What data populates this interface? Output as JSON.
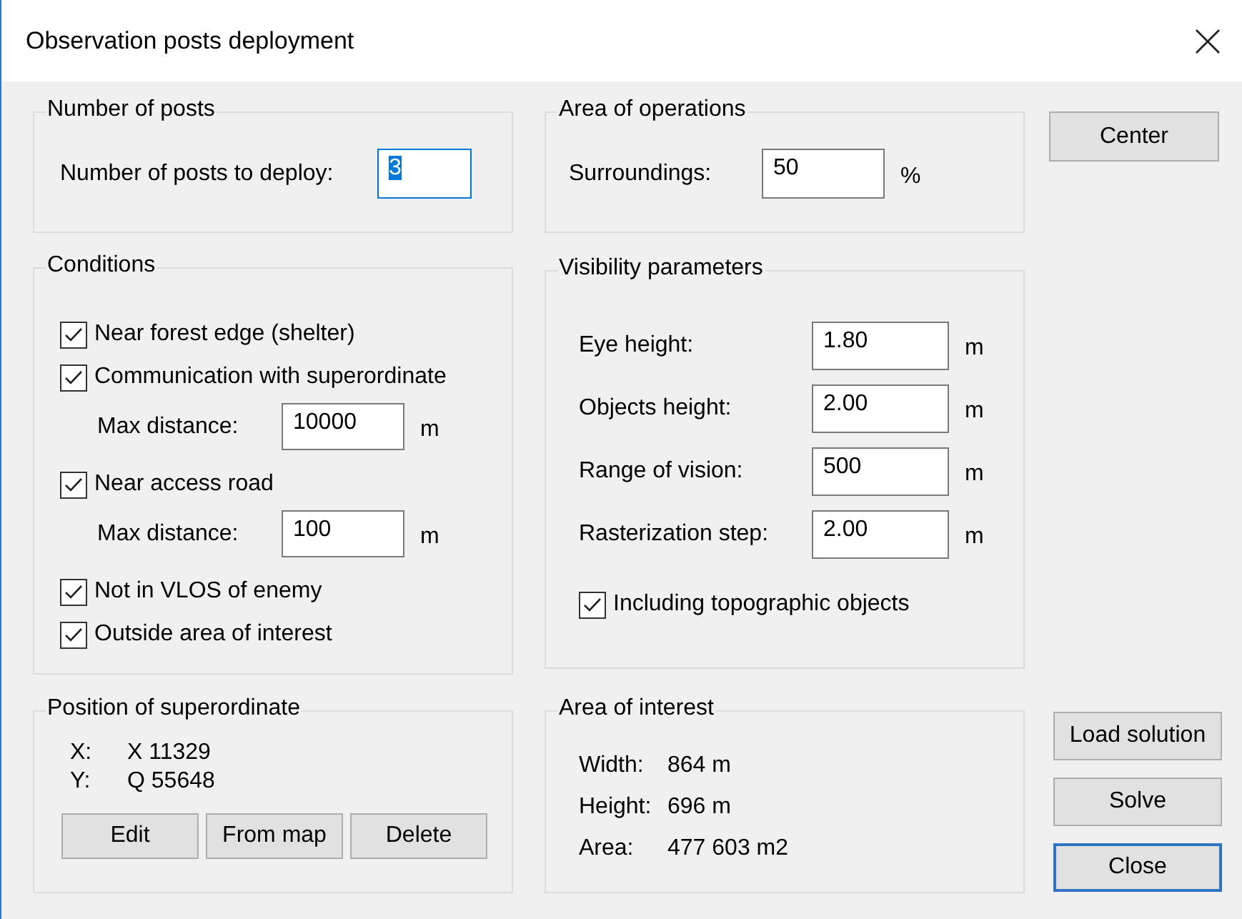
{
  "window": {
    "title": "Observation posts deployment"
  },
  "number_of_posts": {
    "title": "Number of posts",
    "fields": [
      {
        "label": "Number of posts to deploy:",
        "value": "3",
        "focused": true
      }
    ]
  },
  "conditions": {
    "title": "Conditions",
    "items": [
      {
        "kind": "checkbox",
        "label": "Near forest edge (shelter)",
        "checked": true
      },
      {
        "kind": "checkbox",
        "label": "Communication with superordinate",
        "checked": true
      },
      {
        "kind": "field",
        "label": "Max distance:",
        "value": "10000",
        "unit": "m"
      },
      {
        "kind": "checkbox",
        "label": "Near access road",
        "checked": true
      },
      {
        "kind": "field",
        "label": "Max distance:",
        "value": "100",
        "unit": "m"
      },
      {
        "kind": "checkbox",
        "label": "Not in VLOS of enemy",
        "checked": true
      },
      {
        "kind": "checkbox",
        "label": "Outside area of interest",
        "checked": true
      }
    ]
  },
  "position_of_superordinate": {
    "title": "Position of superordinate",
    "coords": [
      {
        "label": "X:",
        "value": "X 11329"
      },
      {
        "label": "Y:",
        "value": "Q 55648"
      }
    ],
    "buttons": [
      "Edit",
      "From map",
      "Delete"
    ]
  },
  "area_of_operations": {
    "title": "Area of operations",
    "fields": [
      {
        "label": "Surroundings:",
        "value": "50",
        "unit": "%",
        "focused": false
      }
    ]
  },
  "visibility_parameters": {
    "title": "Visibility parameters",
    "items": [
      {
        "kind": "field",
        "label": "Eye height:",
        "value": "1.80",
        "unit": "m"
      },
      {
        "kind": "field",
        "label": "Objects height:",
        "value": "2.00",
        "unit": "m"
      },
      {
        "kind": "field",
        "label": "Range of vision:",
        "value": "500",
        "unit": "m"
      },
      {
        "kind": "field",
        "label": "Rasterization step:",
        "value": "2.00",
        "unit": "m"
      },
      {
        "kind": "checkbox",
        "label": "Including topographic objects",
        "checked": true
      }
    ]
  },
  "area_of_interest": {
    "title": "Area of interest",
    "rows": [
      {
        "label": "Width:",
        "value": "864 m"
      },
      {
        "label": "Height:",
        "value": "696 m"
      },
      {
        "label": "Area:",
        "value": "477 603 m2"
      }
    ]
  },
  "buttons": [
    {
      "label": "Center",
      "default": false
    },
    {
      "label": "Load solution",
      "default": false
    },
    {
      "label": "Solve",
      "default": false
    },
    {
      "label": "Close",
      "default": true
    }
  ]
}
